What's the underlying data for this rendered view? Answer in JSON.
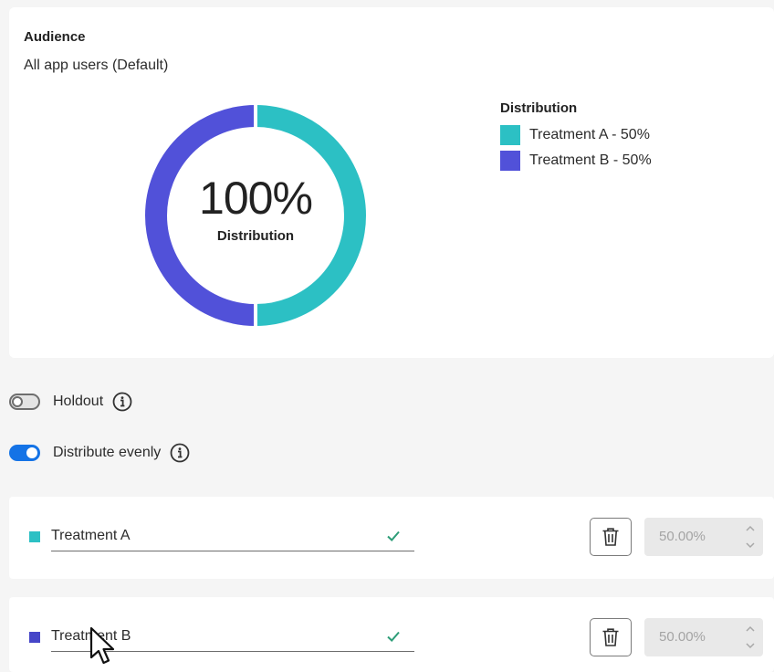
{
  "audience": {
    "heading": "Audience",
    "value": "All app users (Default)"
  },
  "chart_data": {
    "type": "pie",
    "donut": true,
    "center_value": "100%",
    "center_caption": "Distribution",
    "legend_title": "Distribution",
    "legend_position": "right",
    "categories": [
      "Treatment A - 50%",
      "Treatment B - 50%"
    ],
    "values": [
      50,
      50
    ],
    "colors": [
      "#2cc0c4",
      "#5151d9"
    ]
  },
  "holdout": {
    "label": "Holdout",
    "enabled": false,
    "icon": "info-icon"
  },
  "distribute_evenly": {
    "label": "Distribute evenly",
    "enabled": true,
    "icon": "info-icon"
  },
  "treatments": [
    {
      "name": "Treatment A",
      "color": "#2cc0c4",
      "percent": "50.00%",
      "valid": true
    },
    {
      "name": "Treatment B",
      "color": "#4646c8",
      "percent": "50.00%",
      "valid": true
    }
  ],
  "colors": {
    "accent": "#1473e6",
    "check": "#2d9d78"
  }
}
